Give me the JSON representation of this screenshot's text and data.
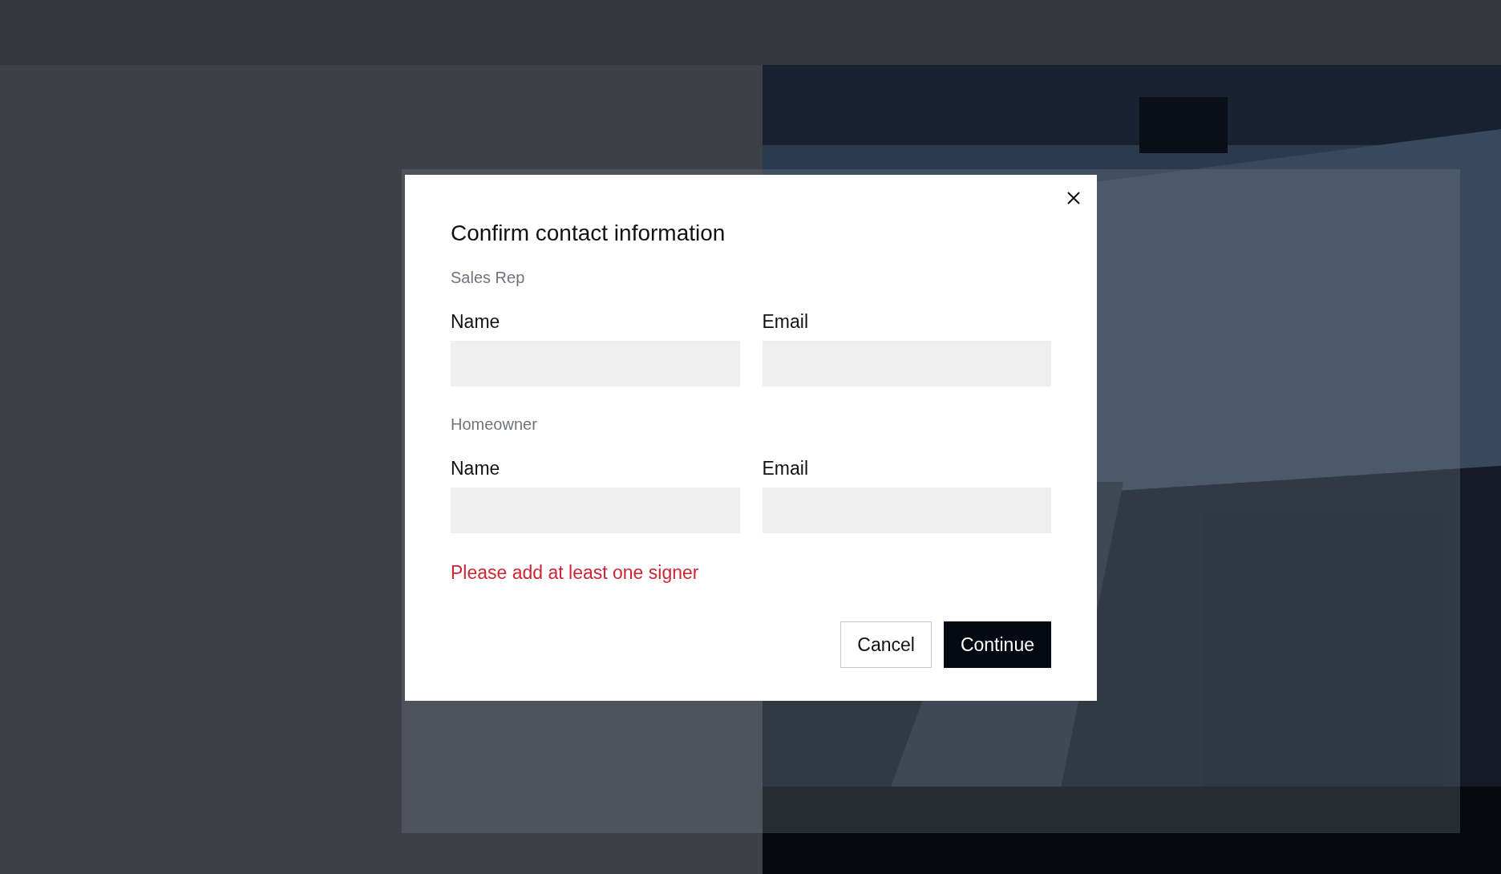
{
  "dialog": {
    "title": "Confirm contact information",
    "sections": [
      {
        "label": "Sales Rep",
        "fields": [
          {
            "label": "Name"
          },
          {
            "label": "Email"
          }
        ]
      },
      {
        "label": "Homeowner",
        "fields": [
          {
            "label": "Name"
          },
          {
            "label": "Email"
          }
        ]
      }
    ],
    "error": "Please add at least one signer",
    "buttons": [
      {
        "label": "Cancel",
        "kind": "secondary"
      },
      {
        "label": "Continue",
        "kind": "primary"
      }
    ]
  }
}
